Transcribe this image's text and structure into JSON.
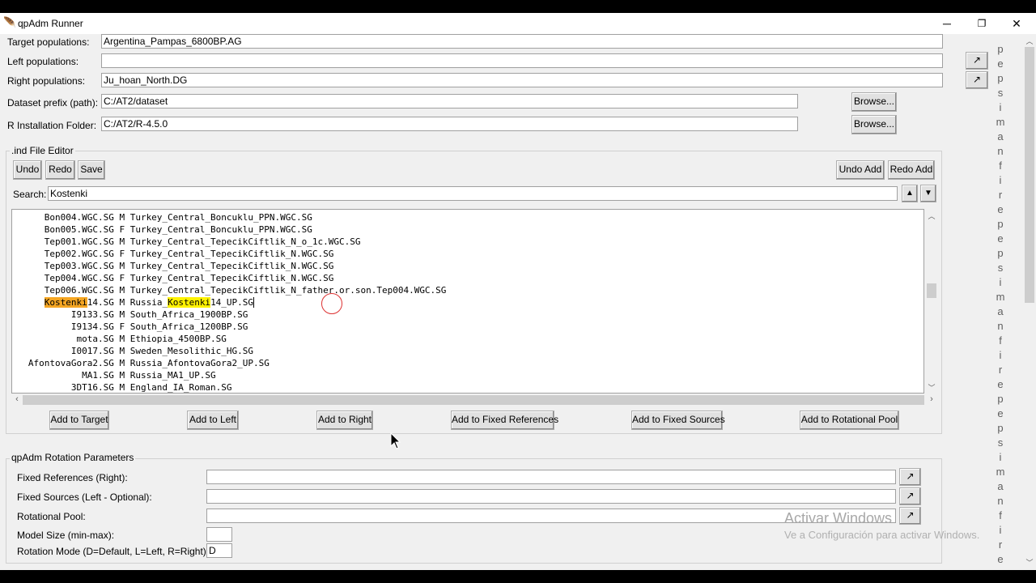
{
  "window": {
    "title": "qpAdm Runner",
    "minimize": "─",
    "restore": "❐",
    "close": "✕"
  },
  "fields": {
    "target": {
      "label": "Target populations:",
      "value": "Argentina_Pampas_6800BP.AG"
    },
    "left": {
      "label": "Left populations:",
      "value": ""
    },
    "right": {
      "label": "Right populations:",
      "value": "Ju_hoan_North.DG"
    },
    "dataset": {
      "label": "Dataset prefix (path):",
      "value": "C:/AT2/dataset",
      "browse": "Browse..."
    },
    "rinstall": {
      "label": "R Installation Folder:",
      "value": "C:/AT2/R-4.5.0",
      "browse": "Browse..."
    }
  },
  "side_buttons": {
    "expand1": "↗",
    "expand2": "↗"
  },
  "ind_editor": {
    "title": ".ind File Editor",
    "undo": "Undo",
    "redo": "Redo",
    "save": "Save",
    "undo_add": "Undo Add",
    "redo_add": "Redo Add",
    "search_label": "Search:",
    "search_value": "Kostenki",
    "search_up": "▲",
    "search_down": "▼",
    "lines": [
      {
        "pre": "      Bon004.WGC.SG M Turkey_Central_Boncuklu_PPN.WGC.SG"
      },
      {
        "pre": "      Bon005.WGC.SG F Turkey_Central_Boncuklu_PPN.WGC.SG"
      },
      {
        "pre": "      Tep001.WGC.SG M Turkey_Central_TepecikCiftlik_N_o_1c.WGC.SG"
      },
      {
        "pre": "      Tep002.WGC.SG F Turkey_Central_TepecikCiftlik_N.WGC.SG"
      },
      {
        "pre": "      Tep003.WGC.SG M Turkey_Central_TepecikCiftlik_N.WGC.SG"
      },
      {
        "pre": "      Tep004.WGC.SG F Turkey_Central_TepecikCiftlik_N.WGC.SG"
      },
      {
        "pre": "      Tep006.WGC.SG M Turkey_Central_TepecikCiftlik_N_father.or.son.Tep004.WGC.SG"
      },
      {
        "pre": "      ",
        "m1": "Kostenki",
        "mid": "14.SG M Russia_",
        "m2": "Kostenki",
        "post": "14_UP.SG"
      },
      {
        "pre": "           I9133.SG M South_Africa_1900BP.SG"
      },
      {
        "pre": "           I9134.SG F South_Africa_1200BP.SG"
      },
      {
        "pre": "            mota.SG M Ethiopia_4500BP.SG"
      },
      {
        "pre": "           I0017.SG M Sweden_Mesolithic_HG.SG"
      },
      {
        "pre": "   AfontovaGora2.SG M Russia_AfontovaGora2_UP.SG"
      },
      {
        "pre": "             MA1.SG M Russia_MA1_UP.SG"
      },
      {
        "pre": "           3DT16.SG M England_IA_Roman.SG"
      }
    ],
    "add_target": "Add to Target",
    "add_left": "Add to Left",
    "add_right": "Add to Right",
    "add_fixed_refs": "Add to Fixed References",
    "add_fixed_sources": "Add to Fixed Sources",
    "add_rot_pool": "Add to Rotational Pool"
  },
  "rotation": {
    "title": "qpAdm Rotation Parameters",
    "fixed_refs_label": "Fixed References (Right):",
    "fixed_refs_value": "",
    "fixed_sources_label": "Fixed Sources (Left - Optional):",
    "fixed_sources_value": "",
    "rot_pool_label": "Rotational Pool:",
    "rot_pool_value": "",
    "model_size_label": "Model Size (min-max):",
    "model_size_value": "",
    "mode_label": "Rotation Mode (D=Default, L=Left, R=Right):",
    "mode_value": "D",
    "expand": "↗"
  },
  "side_letters": [
    "p",
    "e",
    "p",
    "s",
    "i",
    "m",
    "a",
    "n",
    "f",
    "i",
    "r",
    "e",
    "p",
    "e",
    "p",
    "s",
    "i",
    "m",
    "a",
    "n",
    "f",
    "i",
    "r",
    "e",
    "p",
    "e",
    "p",
    "s",
    "i",
    "m",
    "a",
    "n",
    "f",
    "i",
    "r",
    "e"
  ],
  "watermark": {
    "line1": "Activar Windows",
    "line2": "Ve a Configuración para activar Windows."
  }
}
